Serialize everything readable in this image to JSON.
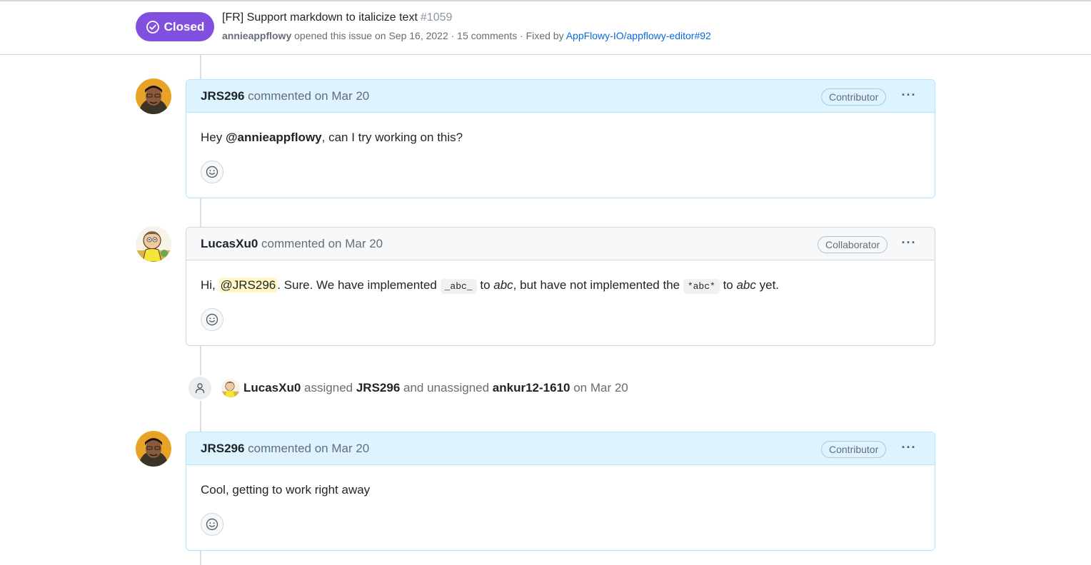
{
  "issue": {
    "state": "Closed",
    "title": "[FR] Support markdown to italicize text",
    "number": "#1059",
    "author": "annieappflowy",
    "opened_text": "opened this issue on Sep 16, 2022 · 15 comments · Fixed by",
    "fixed_by_link": "AppFlowy-IO/appflowy-editor#92"
  },
  "comments": [
    {
      "author": "JRS296",
      "meta": "commented on Mar 20",
      "role": "Contributor",
      "body": {
        "pre": "Hey ",
        "mention": "@annieappflowy",
        "post": ", can I try working on this?"
      }
    },
    {
      "author": "LucasXu0",
      "meta": "commented on Mar 20",
      "role": "Collaborator",
      "body": {
        "pre": "Hi, ",
        "mention": "@JRS296",
        "t1": ". Sure. We have implemented ",
        "code1": "_abc_",
        "t2": " to ",
        "em1": "abc",
        "t3": ", but have not implemented the ",
        "code2": "*abc*",
        "t4": " to ",
        "em2": "abc",
        "t5": " yet."
      }
    },
    {
      "author": "JRS296",
      "meta": "commented on Mar 20",
      "role": "Contributor",
      "body": {
        "text": "Cool, getting to work right away"
      }
    }
  ],
  "event": {
    "actor": "LucasXu0",
    "verb1": "assigned",
    "target1": "JRS296",
    "verb2": "and unassigned",
    "target2": "ankur12-1610",
    "when": "on Mar 20"
  },
  "kebab_glyph": "···",
  "colors": {
    "closed_purple": "#8250df",
    "link_blue": "#0969da",
    "contributor_head_bg": "#ddf4ff",
    "mention_highlight": "#fff8c5"
  },
  "icons": {
    "state": "check-circle-icon",
    "reaction": "smiley-icon",
    "event": "person-icon",
    "menu": "kebab-horizontal-icon"
  }
}
